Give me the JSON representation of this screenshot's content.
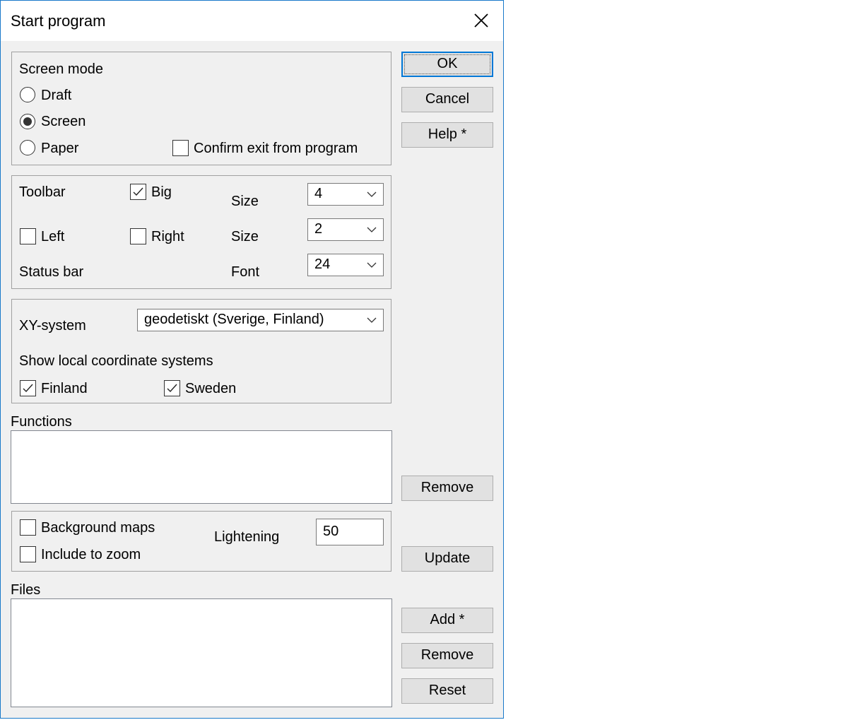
{
  "window": {
    "title": "Start program"
  },
  "screen_mode": {
    "label": "Screen mode",
    "options": [
      {
        "label": "Draft",
        "selected": false
      },
      {
        "label": "Screen",
        "selected": true
      },
      {
        "label": "Paper",
        "selected": false
      }
    ],
    "confirm_exit": {
      "label": "Confirm exit from program",
      "checked": false
    }
  },
  "toolbar": {
    "label": "Toolbar",
    "big": {
      "label": "Big",
      "checked": true
    },
    "size_label": "Size",
    "size_value": "4",
    "left": {
      "label": "Left",
      "checked": false
    },
    "right": {
      "label": "Right",
      "checked": false
    },
    "size2_label": "Size",
    "size2_value": "2",
    "status_bar_label": "Status bar",
    "font_label": "Font",
    "font_value": "24"
  },
  "xy": {
    "label": "XY-system",
    "value": "geodetiskt (Sverige, Finland)",
    "show_local_label": "Show local coordinate systems",
    "finland": {
      "label": "Finland",
      "checked": true
    },
    "sweden": {
      "label": "Sweden",
      "checked": true
    }
  },
  "functions": {
    "label": "Functions",
    "items": []
  },
  "background": {
    "maps": {
      "label": "Background maps",
      "checked": false
    },
    "zoom": {
      "label": "Include to zoom",
      "checked": false
    },
    "lightening_label": "Lightening",
    "lightening_value": "50"
  },
  "files": {
    "label": "Files",
    "items": []
  },
  "buttons": {
    "ok": "OK",
    "cancel": "Cancel",
    "help": "Help *",
    "remove_functions": "Remove",
    "update": "Update",
    "add": "Add *",
    "remove_files": "Remove",
    "reset": "Reset"
  },
  "icons": {
    "close": "close-icon",
    "dropdown": "chevron-down-icon",
    "check": "checkmark-icon"
  }
}
